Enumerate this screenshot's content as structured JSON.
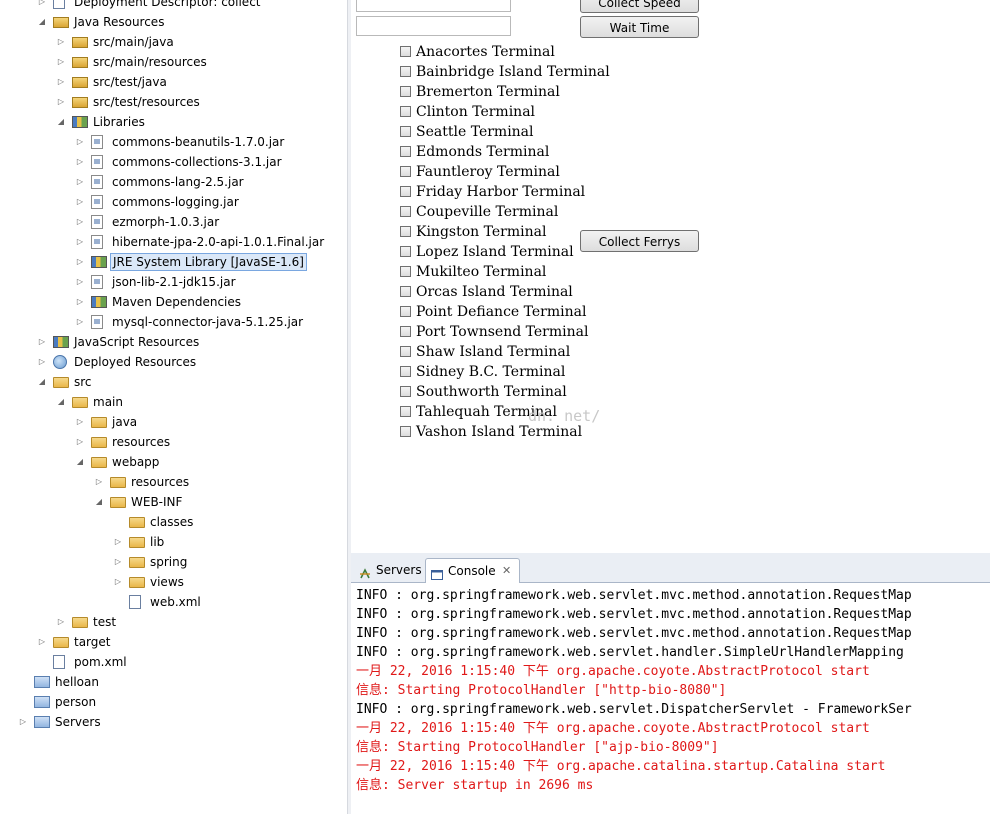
{
  "project_explorer": {
    "rows": [
      {
        "label": "Deployment Descriptor: collect",
        "depth": 1,
        "twisty": "collapsed",
        "icon": "deployment-descriptor-icon"
      },
      {
        "label": "Java Resources",
        "depth": 1,
        "twisty": "expanded",
        "icon": "java-resources-icon"
      },
      {
        "label": "src/main/java",
        "depth": 2,
        "twisty": "collapsed",
        "icon": "source-folder-icon"
      },
      {
        "label": "src/main/resources",
        "depth": 2,
        "twisty": "collapsed",
        "icon": "source-folder-icon"
      },
      {
        "label": "src/test/java",
        "depth": 2,
        "twisty": "collapsed",
        "icon": "source-folder-icon"
      },
      {
        "label": "src/test/resources",
        "depth": 2,
        "twisty": "collapsed",
        "icon": "source-folder-icon"
      },
      {
        "label": "Libraries",
        "depth": 2,
        "twisty": "expanded",
        "icon": "library-icon"
      },
      {
        "label": "commons-beanutils-1.7.0.jar",
        "depth": 3,
        "twisty": "collapsed",
        "icon": "jar-icon"
      },
      {
        "label": "commons-collections-3.1.jar",
        "depth": 3,
        "twisty": "collapsed",
        "icon": "jar-icon"
      },
      {
        "label": "commons-lang-2.5.jar",
        "depth": 3,
        "twisty": "collapsed",
        "icon": "jar-icon"
      },
      {
        "label": "commons-logging.jar",
        "depth": 3,
        "twisty": "collapsed",
        "icon": "jar-icon"
      },
      {
        "label": "ezmorph-1.0.3.jar",
        "depth": 3,
        "twisty": "collapsed",
        "icon": "jar-icon"
      },
      {
        "label": "hibernate-jpa-2.0-api-1.0.1.Final.jar",
        "depth": 3,
        "twisty": "collapsed",
        "icon": "jar-icon"
      },
      {
        "label": "JRE System Library [JavaSE-1.6]",
        "depth": 3,
        "twisty": "collapsed",
        "icon": "library-icon",
        "selected": true
      },
      {
        "label": "json-lib-2.1-jdk15.jar",
        "depth": 3,
        "twisty": "collapsed",
        "icon": "jar-icon"
      },
      {
        "label": "Maven Dependencies",
        "depth": 3,
        "twisty": "collapsed",
        "icon": "library-icon"
      },
      {
        "label": "mysql-connector-java-5.1.25.jar",
        "depth": 3,
        "twisty": "collapsed",
        "icon": "jar-icon"
      },
      {
        "label": "JavaScript Resources",
        "depth": 1,
        "twisty": "collapsed",
        "icon": "javascript-resources-icon"
      },
      {
        "label": "Deployed Resources",
        "depth": 1,
        "twisty": "collapsed",
        "icon": "globe-icon"
      },
      {
        "label": "src",
        "depth": 1,
        "twisty": "expanded",
        "icon": "folder-icon"
      },
      {
        "label": "main",
        "depth": 2,
        "twisty": "expanded",
        "icon": "folder-icon"
      },
      {
        "label": "java",
        "depth": 3,
        "twisty": "collapsed",
        "icon": "folder-icon"
      },
      {
        "label": "resources",
        "depth": 3,
        "twisty": "collapsed",
        "icon": "folder-icon"
      },
      {
        "label": "webapp",
        "depth": 3,
        "twisty": "expanded",
        "icon": "folder-icon"
      },
      {
        "label": "resources",
        "depth": 4,
        "twisty": "collapsed",
        "icon": "folder-icon"
      },
      {
        "label": "WEB-INF",
        "depth": 4,
        "twisty": "expanded",
        "icon": "folder-icon"
      },
      {
        "label": "classes",
        "depth": 5,
        "twisty": "none",
        "icon": "folder-icon"
      },
      {
        "label": "lib",
        "depth": 5,
        "twisty": "collapsed",
        "icon": "folder-icon"
      },
      {
        "label": "spring",
        "depth": 5,
        "twisty": "collapsed",
        "icon": "folder-icon"
      },
      {
        "label": "views",
        "depth": 5,
        "twisty": "collapsed",
        "icon": "folder-icon"
      },
      {
        "label": "web.xml",
        "depth": 5,
        "twisty": "none",
        "icon": "xml-file-icon"
      },
      {
        "label": "test",
        "depth": 2,
        "twisty": "collapsed",
        "icon": "folder-icon"
      },
      {
        "label": "target",
        "depth": 1,
        "twisty": "collapsed",
        "icon": "folder-icon"
      },
      {
        "label": "pom.xml",
        "depth": 1,
        "twisty": "none",
        "icon": "xml-file-icon"
      },
      {
        "label": "helloan",
        "depth": 0,
        "twisty": "none",
        "icon": "project-icon"
      },
      {
        "label": "person",
        "depth": 0,
        "twisty": "none",
        "icon": "project-icon"
      },
      {
        "label": "Servers",
        "depth": 0,
        "twisty": "collapsed",
        "icon": "project-icon"
      }
    ]
  },
  "form": {
    "buttons": {
      "collect_speed": "Collect Speed",
      "wait_time": "Wait Time",
      "collect_ferrys": "Collect Ferrys"
    },
    "terminals": [
      "Anacortes Terminal",
      "Bainbridge Island Terminal",
      "Bremerton Terminal",
      "Clinton Terminal",
      "Seattle Terminal",
      "Edmonds Terminal",
      "Fauntleroy Terminal",
      "Friday Harbor Terminal",
      "Coupeville Terminal",
      "Kingston Terminal",
      "Lopez Island Terminal",
      "Mukilteo Terminal",
      "Orcas Island Terminal",
      "Point Defiance Terminal",
      "Port Townsend Terminal",
      "Shaw Island Terminal",
      "Sidney B.C. Terminal",
      "Southworth Terminal",
      "Tahlequah Terminal",
      "Vashon Island Terminal"
    ],
    "watermark": "dn. net/"
  },
  "console": {
    "tabs": [
      {
        "label": "Servers",
        "icon": "servers-icon"
      },
      {
        "label": "Console",
        "icon": "console-icon",
        "active": true
      }
    ],
    "lines": [
      {
        "text": "INFO : org.springframework.web.servlet.mvc.method.annotation.RequestMap",
        "type": "info"
      },
      {
        "text": "INFO : org.springframework.web.servlet.mvc.method.annotation.RequestMap",
        "type": "info"
      },
      {
        "text": "INFO : org.springframework.web.servlet.mvc.method.annotation.RequestMap",
        "type": "info"
      },
      {
        "text": "INFO : org.springframework.web.servlet.handler.SimpleUrlHandlerMapping",
        "type": "info"
      },
      {
        "text": "一月 22, 2016 1:15:40 下午 org.apache.coyote.AbstractProtocol start",
        "type": "err"
      },
      {
        "text": "信息: Starting ProtocolHandler [\"http-bio-8080\"]",
        "type": "err"
      },
      {
        "text": "INFO : org.springframework.web.servlet.DispatcherServlet - FrameworkSer",
        "type": "info"
      },
      {
        "text": "一月 22, 2016 1:15:40 下午 org.apache.coyote.AbstractProtocol start",
        "type": "err"
      },
      {
        "text": "信息: Starting ProtocolHandler [\"ajp-bio-8009\"]",
        "type": "err"
      },
      {
        "text": "一月 22, 2016 1:15:40 下午 org.apache.catalina.startup.Catalina start",
        "type": "err"
      },
      {
        "text": "信息: Server startup in 2696 ms",
        "type": "err"
      }
    ]
  }
}
